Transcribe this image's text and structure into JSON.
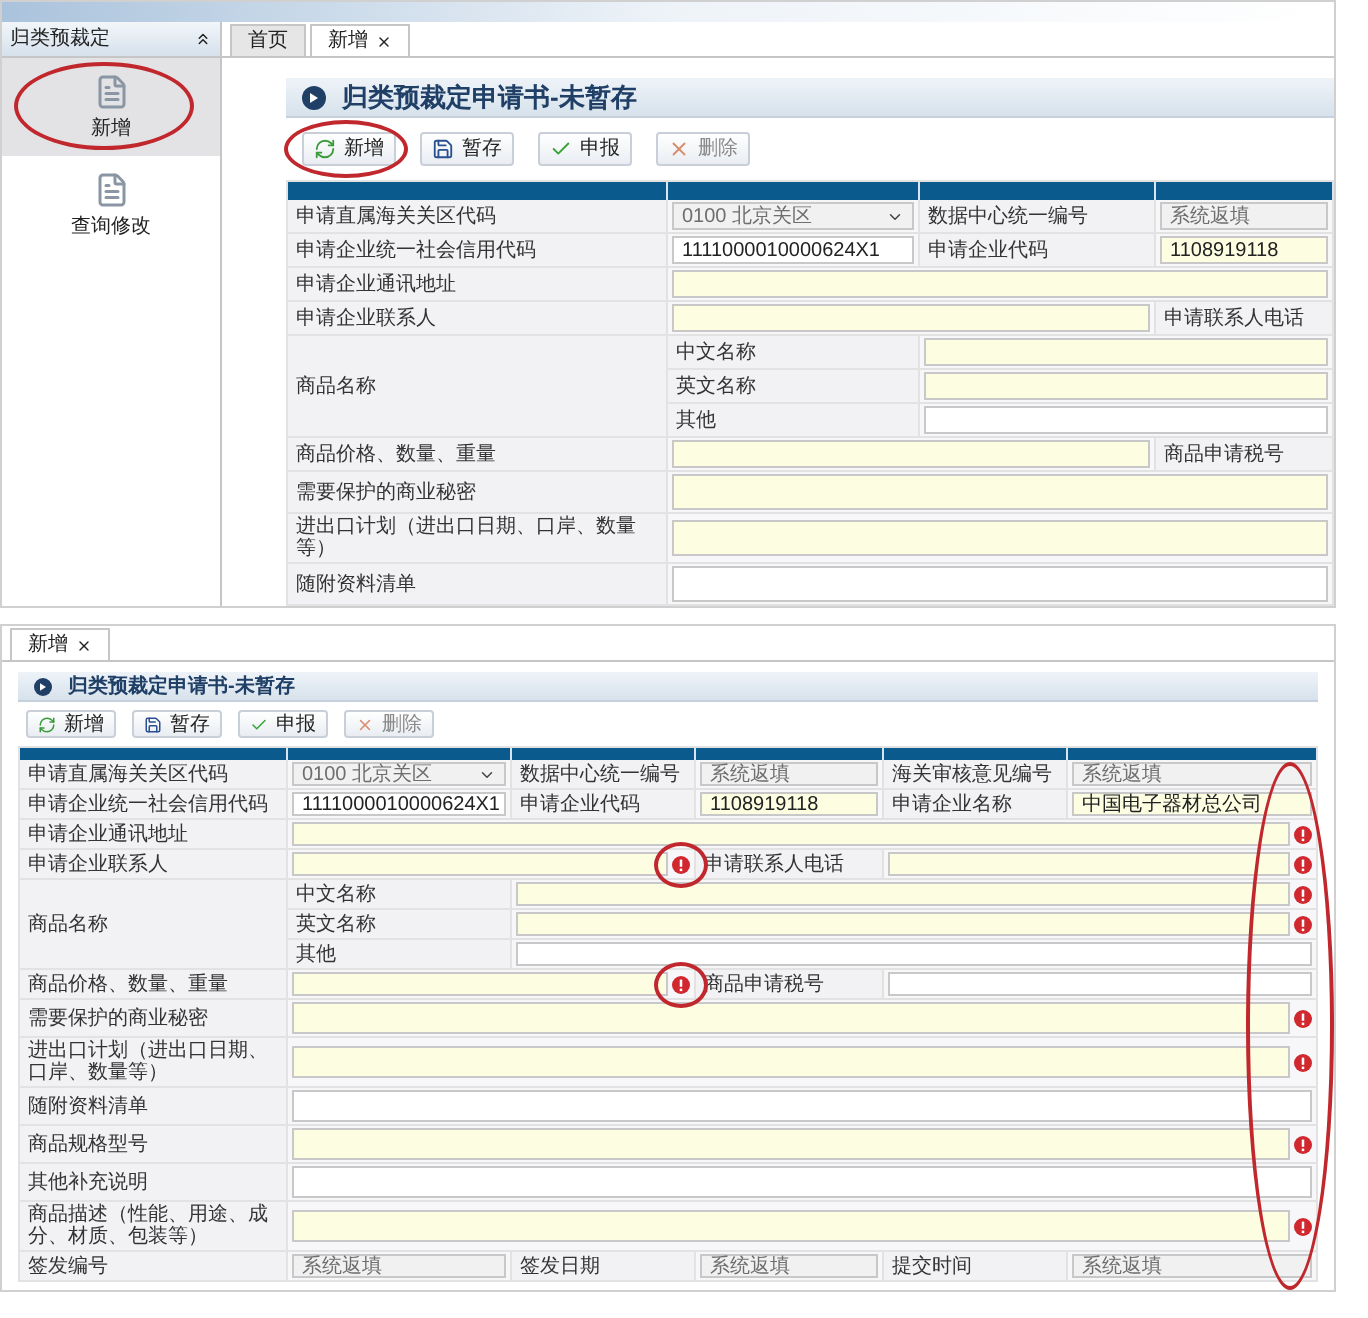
{
  "top": {
    "sidebar": {
      "title": "归类预裁定",
      "items": [
        {
          "label": "新增",
          "selected": true,
          "circled": true
        },
        {
          "label": "查询修改",
          "selected": false,
          "circled": false
        }
      ]
    },
    "tabs": [
      {
        "label": "首页",
        "selected": false,
        "closable": false
      },
      {
        "label": "新增",
        "selected": true,
        "closable": true
      }
    ],
    "form": {
      "title": "归类预裁定申请书-未暂存",
      "buttons": [
        {
          "kind": "add",
          "label": "新增",
          "disabled": false,
          "circled": true
        },
        {
          "kind": "save",
          "label": "暂存",
          "disabled": false,
          "circled": false
        },
        {
          "kind": "submit",
          "label": "申报",
          "disabled": false,
          "circled": false
        },
        {
          "kind": "delete",
          "label": "删除",
          "disabled": true,
          "circled": false
        }
      ],
      "rows": [
        {
          "kind": "fields",
          "cells": [
            {
              "kind": "label",
              "text": "申请直属海关关区代码"
            },
            {
              "kind": "select",
              "value": "0100 北京关区",
              "disabled": true
            },
            {
              "kind": "label",
              "text": "数据中心统一编号"
            },
            {
              "kind": "input",
              "value": "系统返填",
              "disabled": true
            }
          ]
        },
        {
          "kind": "fields",
          "cells": [
            {
              "kind": "label",
              "text": "申请企业统一社会信用代码"
            },
            {
              "kind": "input",
              "value": "1111000010000624X1",
              "required": false,
              "disabled": false
            },
            {
              "kind": "label",
              "text": "申请企业代码"
            },
            {
              "kind": "input",
              "value": "1108919118",
              "required": true,
              "disabled": false
            }
          ]
        },
        {
          "kind": "fields",
          "cells": [
            {
              "kind": "label",
              "text": "申请企业通讯地址"
            },
            {
              "kind": "input",
              "required": true,
              "disabled": false
            }
          ]
        },
        {
          "kind": "fields",
          "cells": [
            {
              "kind": "label",
              "text": "申请企业联系人"
            },
            {
              "kind": "input",
              "required": true,
              "disabled": false
            },
            {
              "kind": "label",
              "text": "申请联系人电话"
            }
          ]
        },
        {
          "kind": "group",
          "label": "商品名称",
          "parts": [
            {
              "label": "中文名称",
              "field": {
                "kind": "input",
                "required": true,
                "disabled": false
              }
            },
            {
              "label": "英文名称",
              "field": {
                "kind": "input",
                "required": true,
                "disabled": false
              }
            },
            {
              "label": "其他",
              "field": {
                "kind": "input",
                "required": false,
                "disabled": false
              }
            }
          ]
        },
        {
          "kind": "fields",
          "cells": [
            {
              "kind": "label",
              "text": "商品价格、数量、重量"
            },
            {
              "kind": "input",
              "required": true,
              "disabled": false
            },
            {
              "kind": "label",
              "text": "商品申请税号"
            }
          ]
        },
        {
          "kind": "fields",
          "cells": [
            {
              "kind": "label",
              "text": "需要保护的商业秘密"
            },
            {
              "kind": "area",
              "required": true,
              "disabled": false
            }
          ]
        },
        {
          "kind": "fields",
          "cells": [
            {
              "kind": "label",
              "text": "进出口计划（进出口日期、口岸、数量等）"
            },
            {
              "kind": "area",
              "required": true,
              "disabled": false
            }
          ]
        },
        {
          "kind": "fields",
          "cells": [
            {
              "kind": "label",
              "text": "随附资料清单"
            },
            {
              "kind": "area",
              "required": false,
              "disabled": false
            }
          ]
        }
      ]
    }
  },
  "bottom": {
    "tabs": [
      {
        "label": "新增",
        "selected": true,
        "closable": true
      }
    ],
    "form": {
      "title": "归类预裁定申请书-未暂存",
      "error_column_circled": true,
      "buttons": [
        {
          "kind": "add",
          "label": "新增",
          "disabled": false,
          "circled": false
        },
        {
          "kind": "save",
          "label": "暂存",
          "disabled": false,
          "circled": false
        },
        {
          "kind": "submit",
          "label": "申报",
          "disabled": false,
          "circled": false
        },
        {
          "kind": "delete",
          "label": "删除",
          "disabled": true,
          "circled": false
        }
      ],
      "rows": [
        {
          "kind": "fields",
          "cells": [
            {
              "kind": "label",
              "text": "申请直属海关关区代码"
            },
            {
              "kind": "select",
              "value": "0100 北京关区",
              "disabled": true,
              "error": false,
              "error_circled": false
            },
            {
              "kind": "label",
              "text": "数据中心统一编号"
            },
            {
              "kind": "input",
              "value": "系统返填",
              "disabled": true,
              "error": false,
              "error_circled": false
            },
            {
              "kind": "label",
              "text": "海关审核意见编号"
            },
            {
              "kind": "input",
              "value": "系统返填",
              "disabled": true,
              "error": false,
              "error_circled": false
            }
          ]
        },
        {
          "kind": "fields",
          "cells": [
            {
              "kind": "label",
              "text": "申请企业统一社会信用代码"
            },
            {
              "kind": "input",
              "value": "1111000010000624X1",
              "required": false,
              "disabled": false,
              "error": false,
              "error_circled": false
            },
            {
              "kind": "label",
              "text": "申请企业代码"
            },
            {
              "kind": "input",
              "value": "1108919118",
              "required": true,
              "disabled": false,
              "error": false,
              "error_circled": false
            },
            {
              "kind": "label",
              "text": "申请企业名称"
            },
            {
              "kind": "input",
              "value": "中国电子器材总公司",
              "required": true,
              "disabled": false,
              "error": false,
              "error_circled": false
            }
          ]
        },
        {
          "kind": "fields",
          "cells": [
            {
              "kind": "label",
              "text": "申请企业通讯地址"
            },
            {
              "kind": "input",
              "required": true,
              "disabled": false,
              "error": true,
              "error_circled": false
            }
          ]
        },
        {
          "kind": "fields",
          "cells": [
            {
              "kind": "label",
              "text": "申请企业联系人"
            },
            {
              "kind": "input",
              "required": true,
              "disabled": false,
              "error": true,
              "error_circled": true
            },
            {
              "kind": "label",
              "text": "申请联系人电话"
            },
            {
              "kind": "input",
              "required": true,
              "disabled": false,
              "error": true,
              "error_circled": false
            }
          ]
        },
        {
          "kind": "group",
          "label": "商品名称",
          "parts": [
            {
              "label": "中文名称",
              "field": {
                "kind": "input",
                "required": true,
                "disabled": false,
                "error": true,
                "error_circled": false
              }
            },
            {
              "label": "英文名称",
              "field": {
                "kind": "input",
                "required": true,
                "disabled": false,
                "error": true,
                "error_circled": false
              }
            },
            {
              "label": "其他",
              "field": {
                "kind": "input",
                "required": false,
                "disabled": false,
                "error": false,
                "error_circled": false
              }
            }
          ]
        },
        {
          "kind": "fields",
          "cells": [
            {
              "kind": "label",
              "text": "商品价格、数量、重量"
            },
            {
              "kind": "input",
              "required": true,
              "disabled": false,
              "error": true,
              "error_circled": true
            },
            {
              "kind": "label",
              "text": "商品申请税号"
            },
            {
              "kind": "input",
              "required": false,
              "disabled": false,
              "error": false,
              "error_circled": false
            }
          ]
        },
        {
          "kind": "fields",
          "cells": [
            {
              "kind": "label",
              "text": "需要保护的商业秘密"
            },
            {
              "kind": "area",
              "required": true,
              "disabled": false,
              "error": true,
              "error_circled": false
            }
          ]
        },
        {
          "kind": "fields",
          "cells": [
            {
              "kind": "label",
              "text": "进出口计划（进出口日期、口岸、数量等）"
            },
            {
              "kind": "area",
              "required": true,
              "disabled": false,
              "error": true,
              "error_circled": false
            }
          ]
        },
        {
          "kind": "fields",
          "cells": [
            {
              "kind": "label",
              "text": "随附资料清单"
            },
            {
              "kind": "area",
              "required": false,
              "disabled": false,
              "error": false,
              "error_circled": false
            }
          ]
        },
        {
          "kind": "fields",
          "cells": [
            {
              "kind": "label",
              "text": "商品规格型号"
            },
            {
              "kind": "area",
              "required": true,
              "disabled": false,
              "error": true,
              "error_circled": false
            }
          ]
        },
        {
          "kind": "fields",
          "cells": [
            {
              "kind": "label",
              "text": "其他补充说明"
            },
            {
              "kind": "area",
              "required": false,
              "disabled": false,
              "error": false,
              "error_circled": false
            }
          ]
        },
        {
          "kind": "fields",
          "cells": [
            {
              "kind": "label",
              "text": "商品描述（性能、用途、成分、材质、包装等）"
            },
            {
              "kind": "area",
              "required": true,
              "disabled": false,
              "error": true,
              "error_circled": false
            }
          ]
        },
        {
          "kind": "fields",
          "cells": [
            {
              "kind": "label",
              "text": "签发编号"
            },
            {
              "kind": "input",
              "value": "系统返填",
              "disabled": true,
              "error": false,
              "error_circled": false
            },
            {
              "kind": "label",
              "text": "签发日期"
            },
            {
              "kind": "input",
              "value": "系统返填",
              "disabled": true,
              "error": false,
              "error_circled": false
            },
            {
              "kind": "label",
              "text": "提交时间"
            },
            {
              "kind": "input",
              "value": "系统返填",
              "disabled": true,
              "error": false,
              "error_circled": false
            }
          ]
        }
      ]
    }
  }
}
